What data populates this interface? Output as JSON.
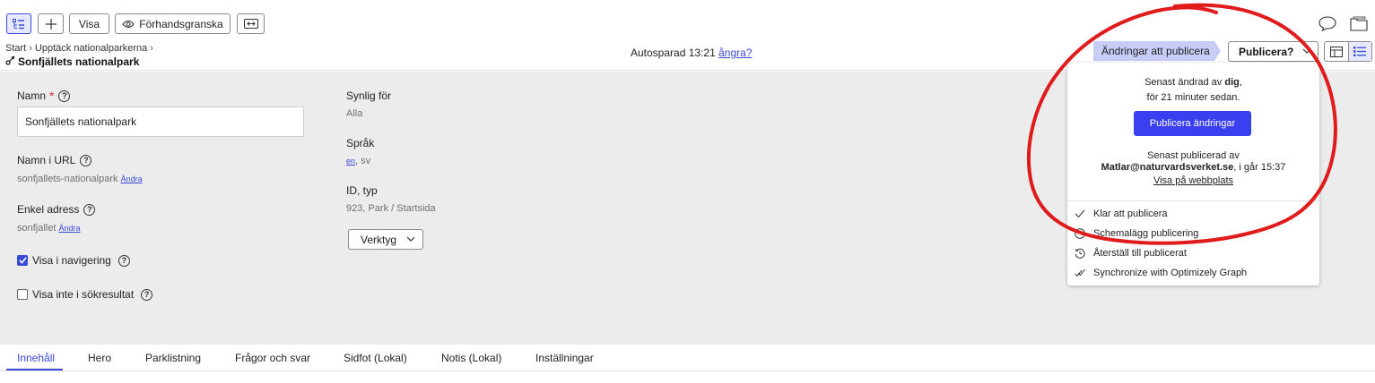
{
  "toolbar": {
    "view_label": "Visa",
    "preview_label": "Förhandsgranska"
  },
  "header": {
    "breadcrumb": [
      "Start",
      "Upptäck nationalparkerna"
    ],
    "page_title": "Sonfjällets nationalpark",
    "autosave_text": "Autosparad 13:21",
    "undo_link": "ångra?",
    "changes_status": "Ändringar att publicera",
    "publish_button": "Publicera?"
  },
  "form": {
    "name_label": "Namn",
    "name_value": "Sonfjällets nationalpark",
    "url_label": "Namn i URL",
    "url_value": "sonfjallets-nationalpark",
    "change_link": "Ändra",
    "simple_address_label": "Enkel adress",
    "simple_address_value": "sonfjallet",
    "show_in_nav_label": "Visa i navigering",
    "show_in_nav_checked": true,
    "hide_in_search_label": "Visa inte i sökresultat",
    "hide_in_search_checked": false,
    "visible_for_label": "Synlig för",
    "visible_for_value": "Alla",
    "language_label": "Språk",
    "language_current": "en",
    "language_rest": ", sv",
    "id_type_label": "ID, typ",
    "id_type_value": "923, Park / Startsida",
    "tools_button": "Verktyg"
  },
  "tabs": [
    {
      "label": "Innehåll",
      "active": true
    },
    {
      "label": "Hero",
      "active": false
    },
    {
      "label": "Parklistning",
      "active": false
    },
    {
      "label": "Frågor och svar",
      "active": false
    },
    {
      "label": "Sidfot (Lokal)",
      "active": false
    },
    {
      "label": "Notis (Lokal)",
      "active": false
    },
    {
      "label": "Inställningar",
      "active": false
    }
  ],
  "publish_menu": {
    "last_changed_prefix": "Senast ändrad av ",
    "last_changed_by": "dig",
    "last_changed_suffix": ",",
    "last_changed_time": "för 21 minuter sedan.",
    "publish_changes_button": "Publicera ändringar",
    "last_published_label": "Senast publicerad av",
    "last_published_by": "Matlar@naturvardsverket.se",
    "last_published_time": ", i går 15:37",
    "view_on_site_link": "Visa på webbplats",
    "items": [
      {
        "label": "Klar att publicera",
        "icon": "checkmark-icon"
      },
      {
        "label": "Schemalägg publicering",
        "icon": "clock-icon"
      },
      {
        "label": "Återställ till publicerat",
        "icon": "history-icon"
      },
      {
        "label": "Synchronize with Optimizely Graph",
        "icon": "double-check-icon"
      }
    ]
  },
  "colors": {
    "accent": "#3a49d6",
    "primary_button": "#3a3ff0",
    "pill": "#c7cdf7",
    "form_background": "#ececec",
    "annotation": "#e01b1b"
  }
}
